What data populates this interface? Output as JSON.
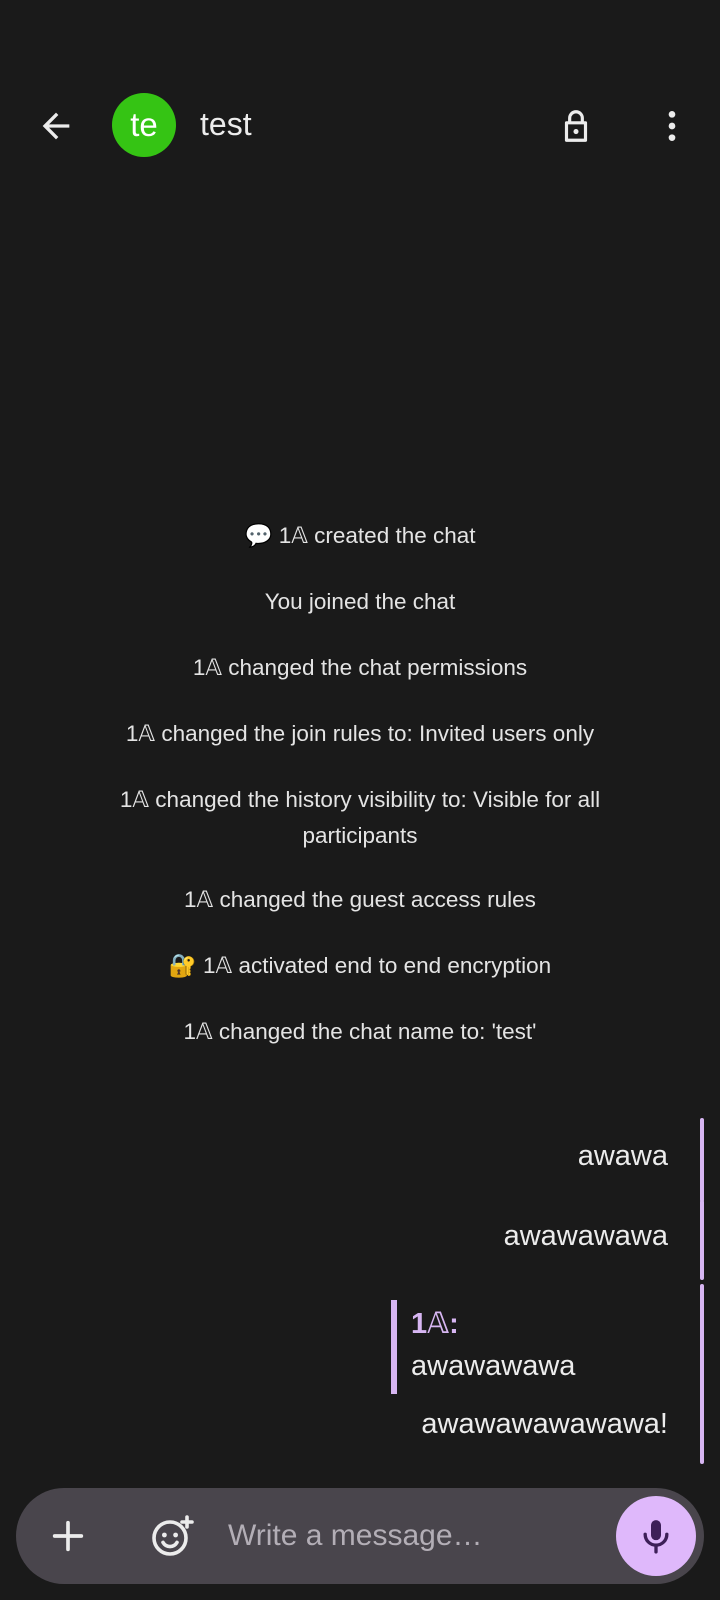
{
  "header": {
    "avatar_initials": "te",
    "avatar_color": "#35c414",
    "title": "test",
    "icons": {
      "back": "arrow-back-icon",
      "encryption": "lock-icon",
      "menu": "more-vert-icon"
    }
  },
  "events": [
    "💬 1𝔸 created the chat",
    "You joined the chat",
    "1𝔸 changed the chat permissions",
    "1𝔸 changed the join rules to: Invited users only",
    "1𝔸 changed the history visibility to: Visible for all participants",
    "1𝔸 changed the guest access rules",
    "🔐 1𝔸 activated end to end encryption",
    "1𝔸 changed the chat name to: 'test'"
  ],
  "messages": [
    {
      "text": "awawa"
    },
    {
      "text": "awawawawa"
    },
    {
      "reply_to": {
        "author": "1𝔸:",
        "text": "awawawawa"
      },
      "text": "awawawawawawa!"
    }
  ],
  "composer": {
    "placeholder": "Write a message…",
    "value": "",
    "icons": {
      "attach": "add-icon",
      "emoji": "add-reaction-icon",
      "voice": "mic-icon"
    }
  },
  "colors": {
    "background": "#1a1a1a",
    "accent": "#d7b6f2",
    "composer_bg": "#49454c",
    "mic_bg": "#dfb8fb"
  }
}
